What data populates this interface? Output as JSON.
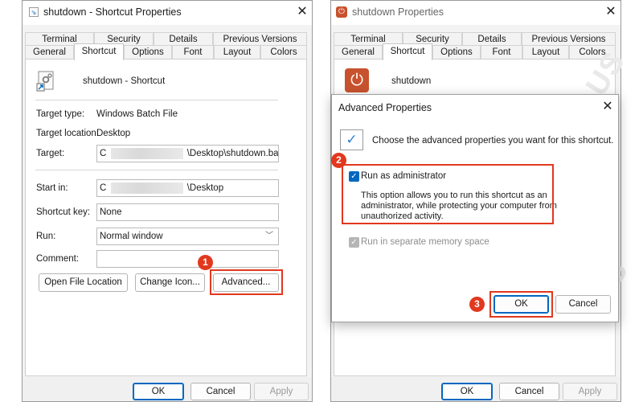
{
  "left_window": {
    "title": "shutdown - Shortcut Properties",
    "tabs_row1": [
      "Terminal",
      "Security",
      "Details",
      "Previous Versions"
    ],
    "tabs_row2": [
      "General",
      "Shortcut",
      "Options",
      "Font",
      "Layout",
      "Colors"
    ],
    "active_tab": "Shortcut",
    "shortcut_name": "shutdown - Shortcut",
    "target_type_label": "Target type:",
    "target_type_value": "Windows Batch File",
    "target_location_label": "Target location:",
    "target_location_value": "Desktop",
    "target_label": "Target:",
    "target_prefix": "C",
    "target_value": "\\Desktop\\shutdown.bat",
    "start_in_label": "Start in:",
    "start_in_prefix": "C",
    "start_in_value": "\\Desktop",
    "shortcut_key_label": "Shortcut key:",
    "shortcut_key_value": "None",
    "run_label": "Run:",
    "run_value": "Normal window",
    "comment_label": "Comment:",
    "comment_value": "",
    "open_file_location": "Open File Location",
    "change_icon": "Change Icon...",
    "advanced": "Advanced...",
    "ok": "OK",
    "cancel": "Cancel",
    "apply": "Apply"
  },
  "right_window": {
    "title": "shutdown Properties",
    "tabs_row1": [
      "Terminal",
      "Security",
      "Details",
      "Previous Versions"
    ],
    "tabs_row2": [
      "General",
      "Shortcut",
      "Options",
      "Font",
      "Layout",
      "Colors"
    ],
    "active_tab": "Shortcut",
    "shortcut_name": "shutdown",
    "ok": "OK",
    "cancel": "Cancel",
    "apply": "Apply"
  },
  "advanced_dialog": {
    "title": "Advanced Properties",
    "header_text": "Choose the advanced properties you want for this shortcut.",
    "run_as_admin_label": "Run as administrator",
    "run_as_admin_checked": true,
    "description_line1": "This option allows you to run this shortcut as an",
    "description_line2": "administrator, while protecting your computer from",
    "description_line3": "unauthorized activity.",
    "separate_memory_label": "Run in separate memory space",
    "separate_memory_checked": true,
    "ok": "OK",
    "cancel": "Cancel"
  },
  "steps": [
    "1",
    "2",
    "3"
  ],
  "colors": {
    "highlight": "#e1381e",
    "accent": "#0067c0"
  },
  "icons": [
    "shortcut-file-icon",
    "power-app-icon",
    "checkmark-icon",
    "close-icon",
    "chevron-down-icon"
  ]
}
